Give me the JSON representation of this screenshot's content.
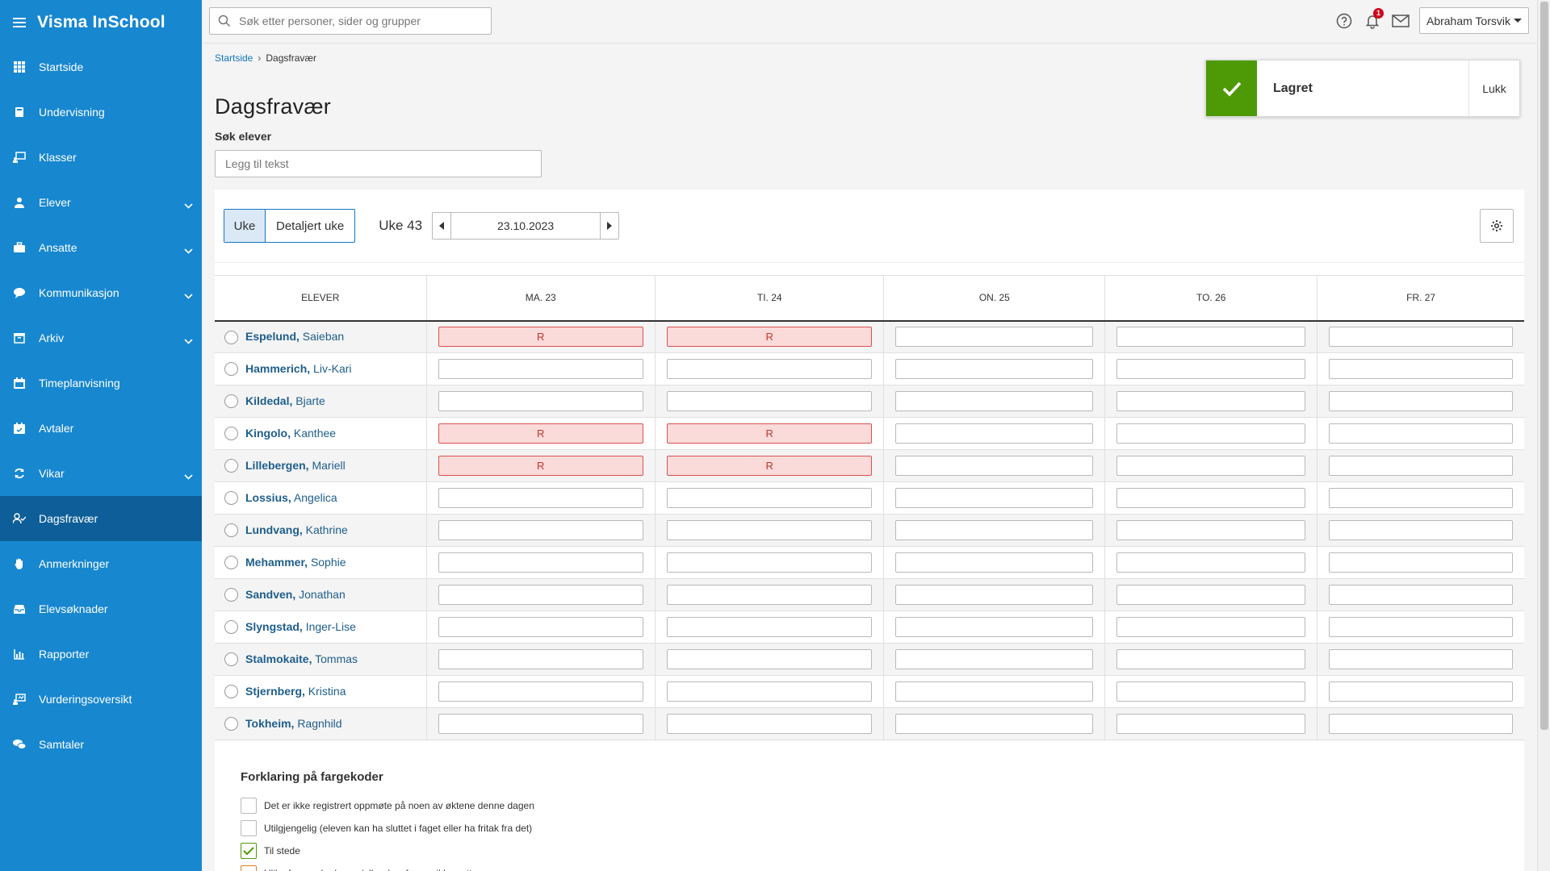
{
  "app": {
    "title": "Visma InSchool"
  },
  "sidebar": {
    "items": [
      {
        "label": "Startside",
        "icon": "grid-icon",
        "expandable": false,
        "active": false
      },
      {
        "label": "Undervisning",
        "icon": "book-icon",
        "expandable": false,
        "active": false
      },
      {
        "label": "Klasser",
        "icon": "classroom-icon",
        "expandable": false,
        "active": false
      },
      {
        "label": "Elever",
        "icon": "student-icon",
        "expandable": true,
        "active": false
      },
      {
        "label": "Ansatte",
        "icon": "briefcase-icon",
        "expandable": true,
        "active": false
      },
      {
        "label": "Kommunikasjon",
        "icon": "chat-icon",
        "expandable": true,
        "active": false
      },
      {
        "label": "Arkiv",
        "icon": "archive-icon",
        "expandable": true,
        "active": false
      },
      {
        "label": "Timeplanvisning",
        "icon": "calendar-icon",
        "expandable": false,
        "active": false
      },
      {
        "label": "Avtaler",
        "icon": "calendar-check-icon",
        "expandable": false,
        "active": false
      },
      {
        "label": "Vikar",
        "icon": "refresh-icon",
        "expandable": true,
        "active": false
      },
      {
        "label": "Dagsfravær",
        "icon": "user-check-icon",
        "expandable": false,
        "active": true
      },
      {
        "label": "Anmerkninger",
        "icon": "hand-icon",
        "expandable": false,
        "active": false
      },
      {
        "label": "Elevsøknader",
        "icon": "inbox-icon",
        "expandable": false,
        "active": false
      },
      {
        "label": "Rapporter",
        "icon": "bar-chart-icon",
        "expandable": false,
        "active": false
      },
      {
        "label": "Vurderingsoversikt",
        "icon": "assessment-icon",
        "expandable": false,
        "active": false
      },
      {
        "label": "Samtaler",
        "icon": "conversation-icon",
        "expandable": false,
        "active": false
      }
    ]
  },
  "topbar": {
    "search_placeholder": "Søk etter personer, sider og grupper",
    "notification_count": "1",
    "user_name": "Abraham Torsvik"
  },
  "breadcrumb": {
    "home": "Startside",
    "current": "Dagsfravær"
  },
  "page": {
    "title": "Dagsfravær",
    "search_label": "Søk elever",
    "search_placeholder": "Legg til tekst"
  },
  "toast": {
    "message": "Lagret",
    "close_label": "Lukk"
  },
  "toolbar": {
    "view_week": "Uke",
    "view_detailed": "Detaljert uke",
    "week_label": "Uke 43",
    "date": "23.10.2023"
  },
  "table": {
    "student_header": "ELEVER",
    "days": [
      "MA. 23",
      "TI. 24",
      "ON. 25",
      "TO. 26",
      "FR. 27"
    ],
    "rows": [
      {
        "surname": "Espelund,",
        "given": "Saieban",
        "cells": [
          "R",
          "R",
          "",
          "",
          ""
        ]
      },
      {
        "surname": "Hammerich,",
        "given": "Liv-Kari",
        "cells": [
          "",
          "",
          "",
          "",
          ""
        ]
      },
      {
        "surname": "Kildedal,",
        "given": "Bjarte",
        "cells": [
          "",
          "",
          "",
          "",
          ""
        ]
      },
      {
        "surname": "Kingolo,",
        "given": "Kanthee",
        "cells": [
          "R",
          "R",
          "",
          "",
          ""
        ]
      },
      {
        "surname": "Lillebergen,",
        "given": "Mariell",
        "cells": [
          "R",
          "R",
          "",
          "",
          ""
        ]
      },
      {
        "surname": "Lossius,",
        "given": "Angelica",
        "cells": [
          "",
          "",
          "",
          "",
          ""
        ]
      },
      {
        "surname": "Lundvang,",
        "given": "Kathrine",
        "cells": [
          "",
          "",
          "",
          "",
          ""
        ]
      },
      {
        "surname": "Mehammer,",
        "given": "Sophie",
        "cells": [
          "",
          "",
          "",
          "",
          ""
        ]
      },
      {
        "surname": "Sandven,",
        "given": "Jonathan",
        "cells": [
          "",
          "",
          "",
          "",
          ""
        ]
      },
      {
        "surname": "Slyngstad,",
        "given": "Inger-Lise",
        "cells": [
          "",
          "",
          "",
          "",
          ""
        ]
      },
      {
        "surname": "Stalmokaite,",
        "given": "Tommas",
        "cells": [
          "",
          "",
          "",
          "",
          ""
        ]
      },
      {
        "surname": "Stjernberg,",
        "given": "Kristina",
        "cells": [
          "",
          "",
          "",
          "",
          ""
        ]
      },
      {
        "surname": "Tokheim,",
        "given": "Ragnhild",
        "cells": [
          "",
          "",
          "",
          "",
          ""
        ]
      }
    ]
  },
  "legend": {
    "title": "Forklaring på fargekoder",
    "items": [
      {
        "text": "Det er ikke registrert oppmøte på noen av øktene denne dagen",
        "style": "empty"
      },
      {
        "text": "Utilgjengelig (eleven kan ha sluttet i faget eller ha fritak fra det)",
        "style": "empty"
      },
      {
        "text": "Til stede",
        "style": "green"
      },
      {
        "text": "Ulike fraværskoder, og/eller dagsfravær ikke satt",
        "style": "orange"
      }
    ]
  },
  "colors": {
    "sidebar": "#1787d0",
    "sidebar_active": "#0e5f99",
    "absence_fill": "#fbdada",
    "absence_border": "#d9534f",
    "success": "#4e9a06"
  }
}
